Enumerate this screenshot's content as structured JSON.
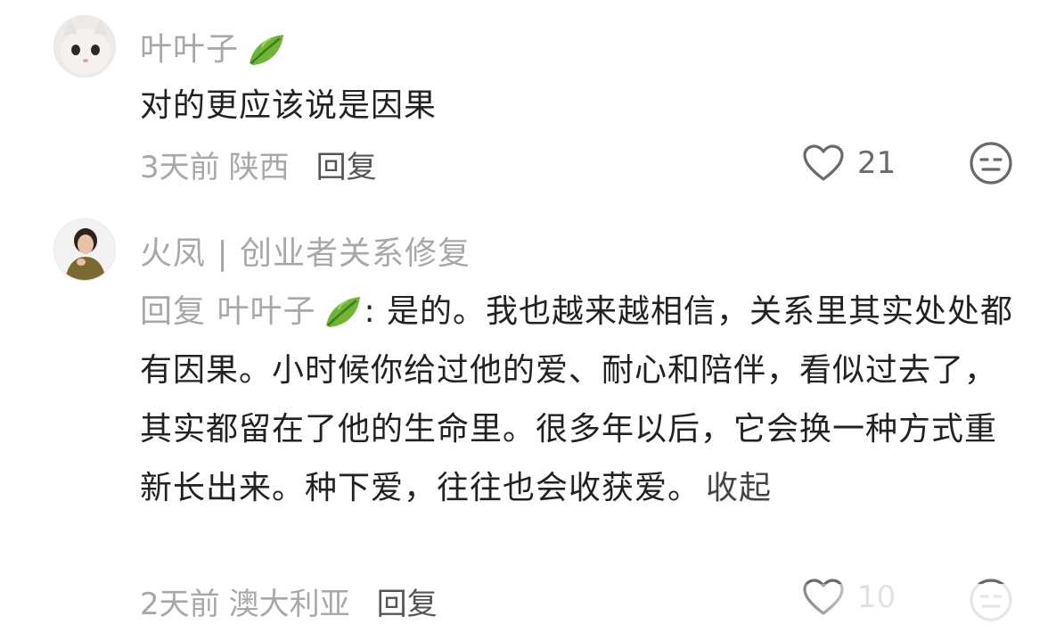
{
  "comments": [
    {
      "username": "叶叶子",
      "avatar": "cat-avatar",
      "badge_icon": "leaf-icon",
      "text": "对的更应该说是因果",
      "time": "3天前",
      "location": "陕西",
      "reply_label": "回复",
      "likes": "21"
    },
    {
      "username": "火凤 | 创业者关系修复",
      "avatar": "woman-avatar",
      "reply_prefix": "回复",
      "reply_target": "叶叶子",
      "badge_icon": "leaf-icon",
      "text": ": 是的。我也越来越相信，关系里其实处处都有因果。小时候你给过他的爱、耐心和陪伴，看似过去了，其实都留在了他的生命里。很多年以后，它会换一种方式重新长出来。种下爱，往往也会收获爱。",
      "collapse_label": "收起",
      "time": "2天前",
      "location": "澳大利亚",
      "reply_label": "回复",
      "likes": "10"
    }
  ],
  "colors": {
    "muted": "#a8a8a8",
    "text": "#222222",
    "leaf": "#5aa02c"
  }
}
